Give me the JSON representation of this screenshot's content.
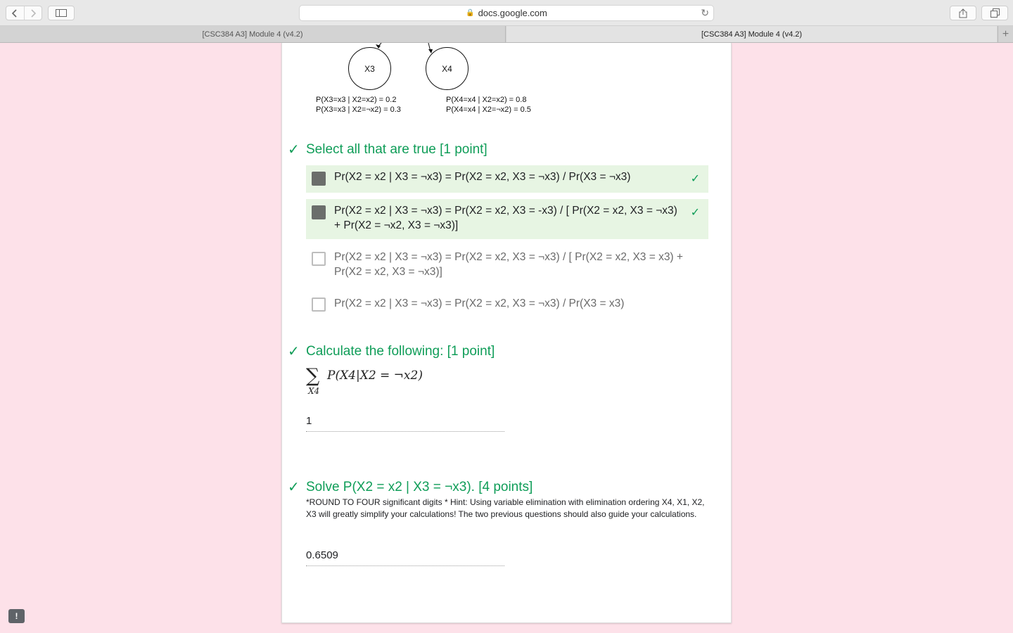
{
  "browser": {
    "url": "docs.google.com",
    "tabs": [
      {
        "label": "[CSC384 A3] Module 4 (v4.2)",
        "active": false
      },
      {
        "label": "[CSC384 A3] Module 4 (v4.2)",
        "active": true
      }
    ]
  },
  "diagram": {
    "nodes": [
      "X3",
      "X4"
    ],
    "cpt_x3": [
      "P(X3=x3 | X2=x2) = 0.2",
      "P(X3=x3 | X2=¬x2) = 0.3"
    ],
    "cpt_x4": [
      "P(X4=x4 | X2=x2) = 0.8",
      "P(X4=x4 | X2=¬x2) = 0.5"
    ]
  },
  "questions": [
    {
      "title": "Select all that are true [1 point]",
      "options": [
        {
          "text": "Pr(X2 = x2 | X3 = ¬x3) = Pr(X2 = x2, X3 = ¬x3) / Pr(X3 = ¬x3)",
          "checked": true,
          "correct": true
        },
        {
          "text": "Pr(X2 = x2 | X3 = ¬x3) = Pr(X2 = x2, X3 = -x3) / [ Pr(X2 = x2, X3 = ¬x3) + Pr(X2 = ¬x2, X3 = ¬x3)]",
          "checked": true,
          "correct": true
        },
        {
          "text": "Pr(X2 = x2 | X3 = ¬x3) = Pr(X2 = x2, X3 = ¬x3) / [ Pr(X2 = x2, X3 = x3) + Pr(X2 = x2, X3 = ¬x3)]",
          "checked": false,
          "correct": false
        },
        {
          "text": "Pr(X2 = x2 | X3 = ¬x3) = Pr(X2 = x2, X3 = ¬x3) / Pr(X3 = x3)",
          "checked": false,
          "correct": false
        }
      ]
    },
    {
      "title": "Calculate the following: [1 point]",
      "formula_sub": "X4",
      "formula_expr": "P(X4|X2 = ¬x2)",
      "answer": "1"
    },
    {
      "title": "Solve P(X2 = x2 | X3 = ¬x3). [4 points]",
      "description": "*ROUND TO FOUR significant digits * Hint: Using variable elimination with elimination ordering X4, X1, X2, X3 will greatly simplify your calculations! The two previous questions should also guide your calculations.",
      "answer": "0.6509"
    }
  ],
  "colors": {
    "page_background": "#fde1e9",
    "correct_green": "#0f9d58",
    "correct_option_bg": "#e7f5e3"
  },
  "icons": {
    "check": "check-icon",
    "feedback": "feedback-icon"
  }
}
